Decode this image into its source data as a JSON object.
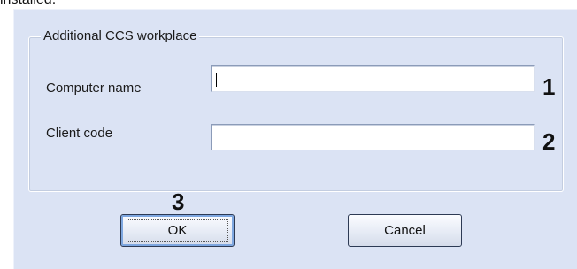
{
  "page": {
    "caption": "installed."
  },
  "dialog": {
    "group_title": "Additional CCS workplace",
    "computer_name": {
      "label": "Computer name",
      "value": ""
    },
    "client_code": {
      "label": "Client code",
      "value": ""
    },
    "ok_label": "OK",
    "cancel_label": "Cancel"
  },
  "callouts": {
    "one": "1",
    "two": "2",
    "three": "3"
  },
  "colors": {
    "dialog_background": "#dbe3f4",
    "default_button_highlight": "#7ea7e0"
  }
}
